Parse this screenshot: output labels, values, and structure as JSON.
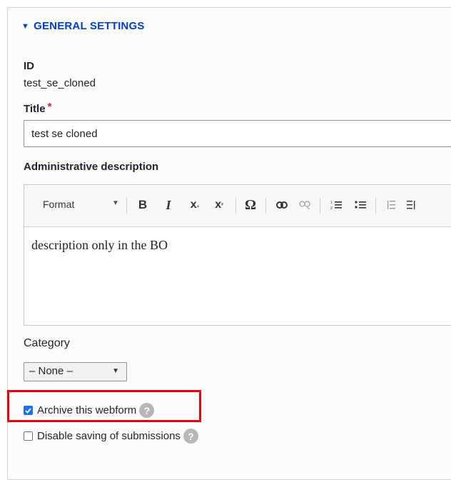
{
  "section": {
    "title": "GENERAL SETTINGS",
    "toggle_icon": "triangle-down-icon"
  },
  "id_field": {
    "label": "ID",
    "value": "test_se_cloned"
  },
  "title_field": {
    "label": "Title",
    "required_mark": "*",
    "value": "test se cloned"
  },
  "description_field": {
    "label": "Administrative description",
    "format_label": "Format",
    "content": "description only in the BO",
    "toolbar_icons": [
      "bold-icon",
      "italic-icon",
      "subscript-icon",
      "superscript-icon",
      "special-char-icon",
      "link-icon",
      "unlink-icon",
      "numbered-list-icon",
      "bulleted-list-icon",
      "outdent-icon",
      "indent-icon"
    ]
  },
  "category_field": {
    "label": "Category",
    "selected": "– None –"
  },
  "checkboxes": [
    {
      "label": "Archive this webform",
      "checked": true
    },
    {
      "label": "Disable saving of submissions",
      "checked": false
    }
  ],
  "colors": {
    "accent": "#003ecc",
    "highlight": "#e8000c",
    "checkbox": "#1a73e8",
    "required": "#dc2323"
  }
}
